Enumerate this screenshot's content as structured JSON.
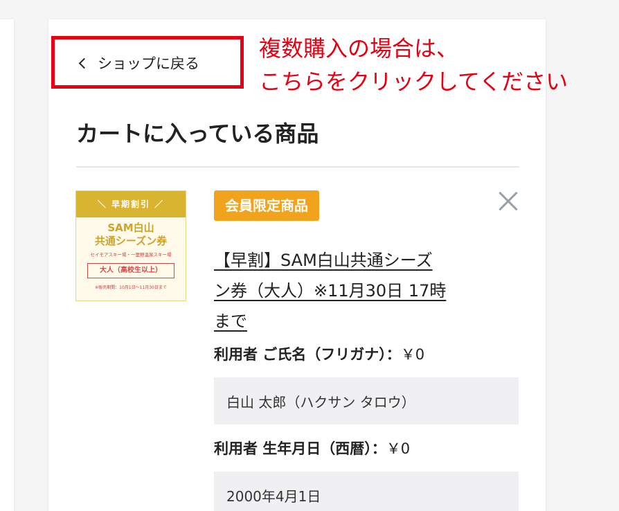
{
  "back_link": {
    "label": "ショップに戻る"
  },
  "annotation": {
    "line1": "複数購入の場合は、",
    "line2": "こちらをクリックしてください"
  },
  "cart": {
    "title": "カートに入っている商品"
  },
  "product": {
    "thumbnail": {
      "header": "＼ 早期割引 ／",
      "title_line1": "SAM白山",
      "title_line2": "共通シーズン券",
      "subtitle": "セイモアスキー場・一里野温泉スキー場",
      "badge": "大人（高校生以上）",
      "note": "※販売期間：10月1日〜11月30日まで"
    },
    "badge": "会員限定商品",
    "name_line1": "【早割】SAM白山共通シーズ",
    "name_line2": "ン券（大人）※11月30日 17時",
    "name_line3": "まで",
    "close_icon": "close-icon",
    "fields": [
      {
        "label": "利用者 ご氏名（フリガナ）：",
        "price": "￥0",
        "value": "白山 太郎（ハクサン タロウ）"
      },
      {
        "label": "利用者 生年月日（西暦）：",
        "price": "￥0",
        "value": "2000年4月1日"
      }
    ]
  },
  "colors": {
    "highlight": "#e60012",
    "member_badge": "#f2a31d",
    "field_bg": "#f0f0f2"
  }
}
